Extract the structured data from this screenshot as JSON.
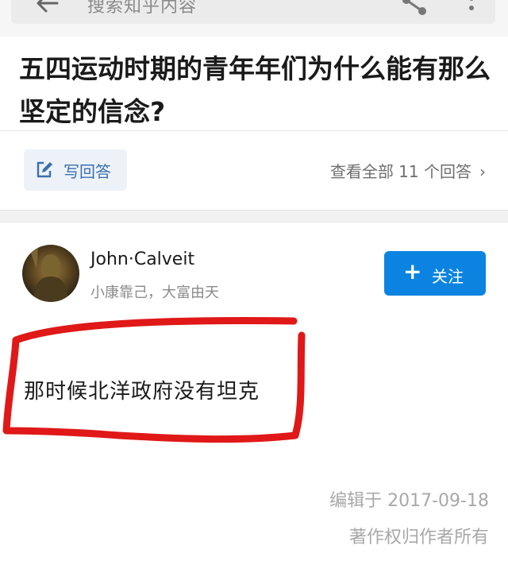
{
  "search": {
    "placeholder": "搜索知乎内容"
  },
  "question": {
    "title": "五四运动时期的青年年们为什么能有那么坚定的信念?"
  },
  "actions": {
    "write_answer": "写回答",
    "view_all": "查看全部 11 个回答",
    "view_all_chevron": "›"
  },
  "author": {
    "name": "John·Calveit",
    "bio": "小康靠己，大富由天",
    "follow_plus": "+",
    "follow_label": "关注"
  },
  "answer": {
    "text": "那时候北洋政府没有坦克",
    "edited": "编辑于 2017-09-18",
    "copyright": "著作权归作者所有"
  },
  "colors": {
    "accent": "#0a84e0",
    "link": "#3a6fb0",
    "annotation": "#e01818"
  },
  "icons": [
    "back-arrow-icon",
    "share-icon",
    "more-icon",
    "edit-icon"
  ]
}
